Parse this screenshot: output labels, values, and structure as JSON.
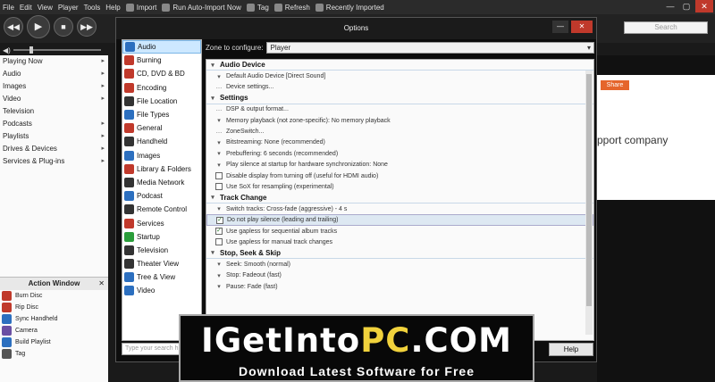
{
  "menubar": {
    "items": [
      "File",
      "Edit",
      "View",
      "Player",
      "Tools",
      "Help"
    ],
    "toolbar": [
      "Import",
      "Run Auto-Import Now",
      "Tag",
      "Refresh",
      "Recently Imported"
    ]
  },
  "window_controls": {
    "minimize": "—",
    "maximize": "▢",
    "close": "✕"
  },
  "transport": {
    "prev": "◀◀",
    "play": "▶",
    "stop": "■",
    "next": "▶▶"
  },
  "search": {
    "placeholder": "Search"
  },
  "tree": [
    {
      "label": "Playing Now",
      "arrow": "▸"
    },
    {
      "label": "Audio",
      "arrow": "▸"
    },
    {
      "label": "Images",
      "arrow": "▸"
    },
    {
      "label": "Video",
      "arrow": "▸"
    },
    {
      "label": "Television",
      "arrow": ""
    },
    {
      "label": "Podcasts",
      "arrow": "▸"
    },
    {
      "label": "Playlists",
      "arrow": "▸"
    },
    {
      "label": "Drives & Devices",
      "arrow": "▸"
    },
    {
      "label": "Services & Plug-ins",
      "arrow": "▸"
    }
  ],
  "action_window": {
    "title": "Action Window",
    "close": "✕",
    "items": [
      {
        "label": "Burn Disc",
        "color": "#c0392b"
      },
      {
        "label": "Rip Disc",
        "color": "#c0392b"
      },
      {
        "label": "Sync Handheld",
        "color": "#2c6fbf"
      },
      {
        "label": "Camera",
        "color": "#6a4fa3"
      },
      {
        "label": "Build Playlist",
        "color": "#2c6fbf"
      },
      {
        "label": "Tag",
        "color": "#555555"
      }
    ]
  },
  "background": {
    "share": "Share",
    "text": "pport company"
  },
  "dialog": {
    "title": "Options",
    "minimize": "—",
    "close": "✕",
    "zone_label": "Zone to configure:",
    "zone_value": "Player",
    "categories": [
      {
        "label": "Audio",
        "color": "#2c6fbf",
        "selected": true
      },
      {
        "label": "Burning",
        "color": "#c0392b"
      },
      {
        "label": "CD, DVD & BD",
        "color": "#c0392b"
      },
      {
        "label": "Encoding",
        "color": "#c0392b"
      },
      {
        "label": "File Location",
        "color": "#333333"
      },
      {
        "label": "File Types",
        "color": "#2c6fbf"
      },
      {
        "label": "General",
        "color": "#c0392b"
      },
      {
        "label": "Handheld",
        "color": "#333333"
      },
      {
        "label": "Images",
        "color": "#2c6fbf"
      },
      {
        "label": "Library & Folders",
        "color": "#c0392b"
      },
      {
        "label": "Media Network",
        "color": "#333333"
      },
      {
        "label": "Podcast",
        "color": "#2c6fbf"
      },
      {
        "label": "Remote Control",
        "color": "#333333"
      },
      {
        "label": "Services",
        "color": "#c0392b"
      },
      {
        "label": "Startup",
        "color": "#2a9d3a"
      },
      {
        "label": "Television",
        "color": "#333333"
      },
      {
        "label": "Theater View",
        "color": "#333333"
      },
      {
        "label": "Tree & View",
        "color": "#2c6fbf"
      },
      {
        "label": "Video",
        "color": "#2c6fbf"
      }
    ],
    "sections": [
      {
        "title": "Audio Device",
        "rows": [
          {
            "mark": "▾",
            "text": "Default Audio Device [Direct Sound]"
          },
          {
            "mark": "…",
            "text": "Device settings..."
          }
        ]
      },
      {
        "title": "Settings",
        "rows": [
          {
            "mark": "…",
            "text": "DSP & output format..."
          },
          {
            "mark": "▾",
            "text": "Memory playback (not zone-specific): No memory playback"
          },
          {
            "mark": "…",
            "text": "ZoneSwitch..."
          },
          {
            "mark": "▾",
            "text": "Bitstreaming: None (recommended)"
          },
          {
            "mark": "▾",
            "text": "Prebuffering: 6 seconds (recommended)"
          },
          {
            "mark": "▾",
            "text": "Play silence at startup for hardware synchronization: None"
          },
          {
            "mark": "box",
            "checked": false,
            "text": "Disable display from turning off (useful for HDMI audio)"
          },
          {
            "mark": "box",
            "checked": false,
            "text": "Use SoX for resampling (experimental)"
          }
        ]
      },
      {
        "title": "Track Change",
        "rows": [
          {
            "mark": "▾",
            "text": "Switch tracks: Cross-fade (aggressive) - 4 s"
          },
          {
            "mark": "box",
            "checked": true,
            "text": "Do not play silence (leading and trailing)",
            "highlight": true
          },
          {
            "mark": "box",
            "checked": true,
            "text": "Use gapless for sequential album tracks"
          },
          {
            "mark": "box",
            "checked": false,
            "text": "Use gapless for manual track changes"
          }
        ]
      },
      {
        "title": "Stop, Seek & Skip",
        "rows": [
          {
            "mark": "▾",
            "text": "Seek: Smooth (normal)"
          },
          {
            "mark": "▾",
            "text": "Stop: Fadeout (fast)"
          },
          {
            "mark": "▾",
            "text": "Pause: Fade (fast)"
          }
        ]
      }
    ],
    "type_search_placeholder": "Type your search h",
    "help": "Help"
  },
  "banner": {
    "line1_a": "IGetInto",
    "line1_b": "PC",
    "line1_c": ".COM",
    "line2": "Download Latest Software for Free"
  }
}
